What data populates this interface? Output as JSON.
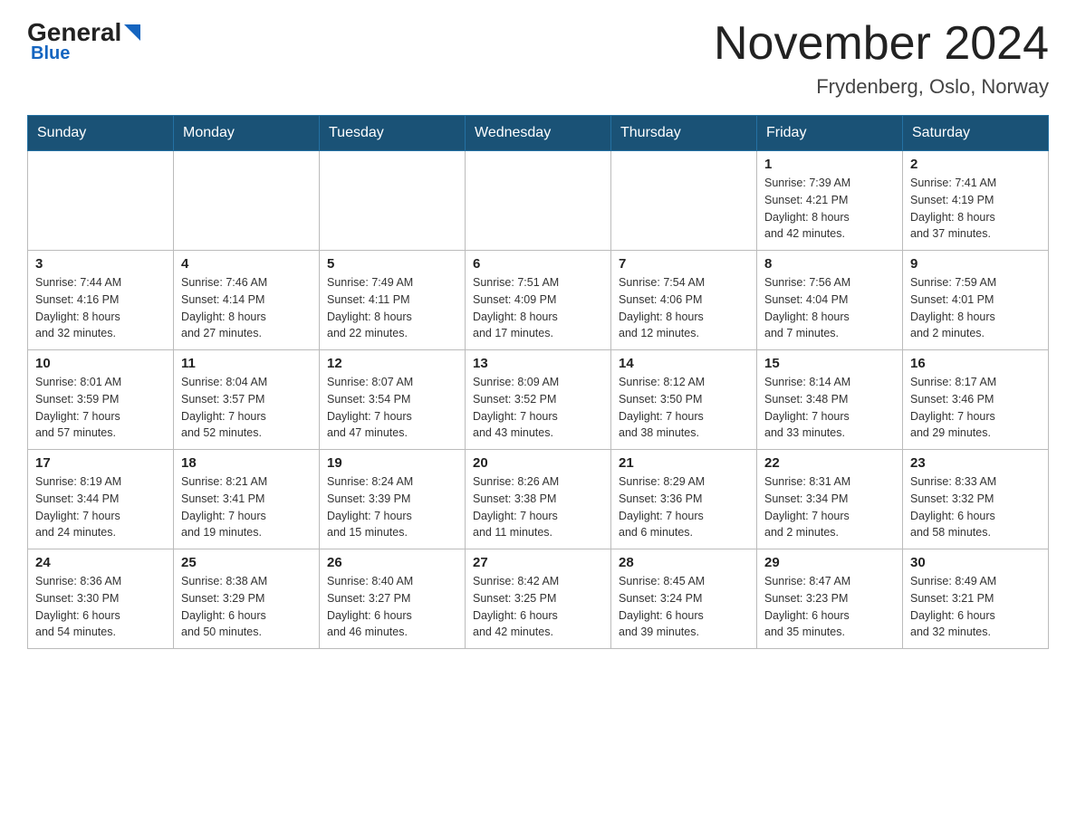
{
  "header": {
    "logo_general": "General",
    "logo_blue": "Blue",
    "month_title": "November 2024",
    "location": "Frydenberg, Oslo, Norway"
  },
  "weekdays": [
    "Sunday",
    "Monday",
    "Tuesday",
    "Wednesday",
    "Thursday",
    "Friday",
    "Saturday"
  ],
  "weeks": [
    [
      {
        "day": "",
        "info": ""
      },
      {
        "day": "",
        "info": ""
      },
      {
        "day": "",
        "info": ""
      },
      {
        "day": "",
        "info": ""
      },
      {
        "day": "",
        "info": ""
      },
      {
        "day": "1",
        "info": "Sunrise: 7:39 AM\nSunset: 4:21 PM\nDaylight: 8 hours\nand 42 minutes."
      },
      {
        "day": "2",
        "info": "Sunrise: 7:41 AM\nSunset: 4:19 PM\nDaylight: 8 hours\nand 37 minutes."
      }
    ],
    [
      {
        "day": "3",
        "info": "Sunrise: 7:44 AM\nSunset: 4:16 PM\nDaylight: 8 hours\nand 32 minutes."
      },
      {
        "day": "4",
        "info": "Sunrise: 7:46 AM\nSunset: 4:14 PM\nDaylight: 8 hours\nand 27 minutes."
      },
      {
        "day": "5",
        "info": "Sunrise: 7:49 AM\nSunset: 4:11 PM\nDaylight: 8 hours\nand 22 minutes."
      },
      {
        "day": "6",
        "info": "Sunrise: 7:51 AM\nSunset: 4:09 PM\nDaylight: 8 hours\nand 17 minutes."
      },
      {
        "day": "7",
        "info": "Sunrise: 7:54 AM\nSunset: 4:06 PM\nDaylight: 8 hours\nand 12 minutes."
      },
      {
        "day": "8",
        "info": "Sunrise: 7:56 AM\nSunset: 4:04 PM\nDaylight: 8 hours\nand 7 minutes."
      },
      {
        "day": "9",
        "info": "Sunrise: 7:59 AM\nSunset: 4:01 PM\nDaylight: 8 hours\nand 2 minutes."
      }
    ],
    [
      {
        "day": "10",
        "info": "Sunrise: 8:01 AM\nSunset: 3:59 PM\nDaylight: 7 hours\nand 57 minutes."
      },
      {
        "day": "11",
        "info": "Sunrise: 8:04 AM\nSunset: 3:57 PM\nDaylight: 7 hours\nand 52 minutes."
      },
      {
        "day": "12",
        "info": "Sunrise: 8:07 AM\nSunset: 3:54 PM\nDaylight: 7 hours\nand 47 minutes."
      },
      {
        "day": "13",
        "info": "Sunrise: 8:09 AM\nSunset: 3:52 PM\nDaylight: 7 hours\nand 43 minutes."
      },
      {
        "day": "14",
        "info": "Sunrise: 8:12 AM\nSunset: 3:50 PM\nDaylight: 7 hours\nand 38 minutes."
      },
      {
        "day": "15",
        "info": "Sunrise: 8:14 AM\nSunset: 3:48 PM\nDaylight: 7 hours\nand 33 minutes."
      },
      {
        "day": "16",
        "info": "Sunrise: 8:17 AM\nSunset: 3:46 PM\nDaylight: 7 hours\nand 29 minutes."
      }
    ],
    [
      {
        "day": "17",
        "info": "Sunrise: 8:19 AM\nSunset: 3:44 PM\nDaylight: 7 hours\nand 24 minutes."
      },
      {
        "day": "18",
        "info": "Sunrise: 8:21 AM\nSunset: 3:41 PM\nDaylight: 7 hours\nand 19 minutes."
      },
      {
        "day": "19",
        "info": "Sunrise: 8:24 AM\nSunset: 3:39 PM\nDaylight: 7 hours\nand 15 minutes."
      },
      {
        "day": "20",
        "info": "Sunrise: 8:26 AM\nSunset: 3:38 PM\nDaylight: 7 hours\nand 11 minutes."
      },
      {
        "day": "21",
        "info": "Sunrise: 8:29 AM\nSunset: 3:36 PM\nDaylight: 7 hours\nand 6 minutes."
      },
      {
        "day": "22",
        "info": "Sunrise: 8:31 AM\nSunset: 3:34 PM\nDaylight: 7 hours\nand 2 minutes."
      },
      {
        "day": "23",
        "info": "Sunrise: 8:33 AM\nSunset: 3:32 PM\nDaylight: 6 hours\nand 58 minutes."
      }
    ],
    [
      {
        "day": "24",
        "info": "Sunrise: 8:36 AM\nSunset: 3:30 PM\nDaylight: 6 hours\nand 54 minutes."
      },
      {
        "day": "25",
        "info": "Sunrise: 8:38 AM\nSunset: 3:29 PM\nDaylight: 6 hours\nand 50 minutes."
      },
      {
        "day": "26",
        "info": "Sunrise: 8:40 AM\nSunset: 3:27 PM\nDaylight: 6 hours\nand 46 minutes."
      },
      {
        "day": "27",
        "info": "Sunrise: 8:42 AM\nSunset: 3:25 PM\nDaylight: 6 hours\nand 42 minutes."
      },
      {
        "day": "28",
        "info": "Sunrise: 8:45 AM\nSunset: 3:24 PM\nDaylight: 6 hours\nand 39 minutes."
      },
      {
        "day": "29",
        "info": "Sunrise: 8:47 AM\nSunset: 3:23 PM\nDaylight: 6 hours\nand 35 minutes."
      },
      {
        "day": "30",
        "info": "Sunrise: 8:49 AM\nSunset: 3:21 PM\nDaylight: 6 hours\nand 32 minutes."
      }
    ]
  ]
}
